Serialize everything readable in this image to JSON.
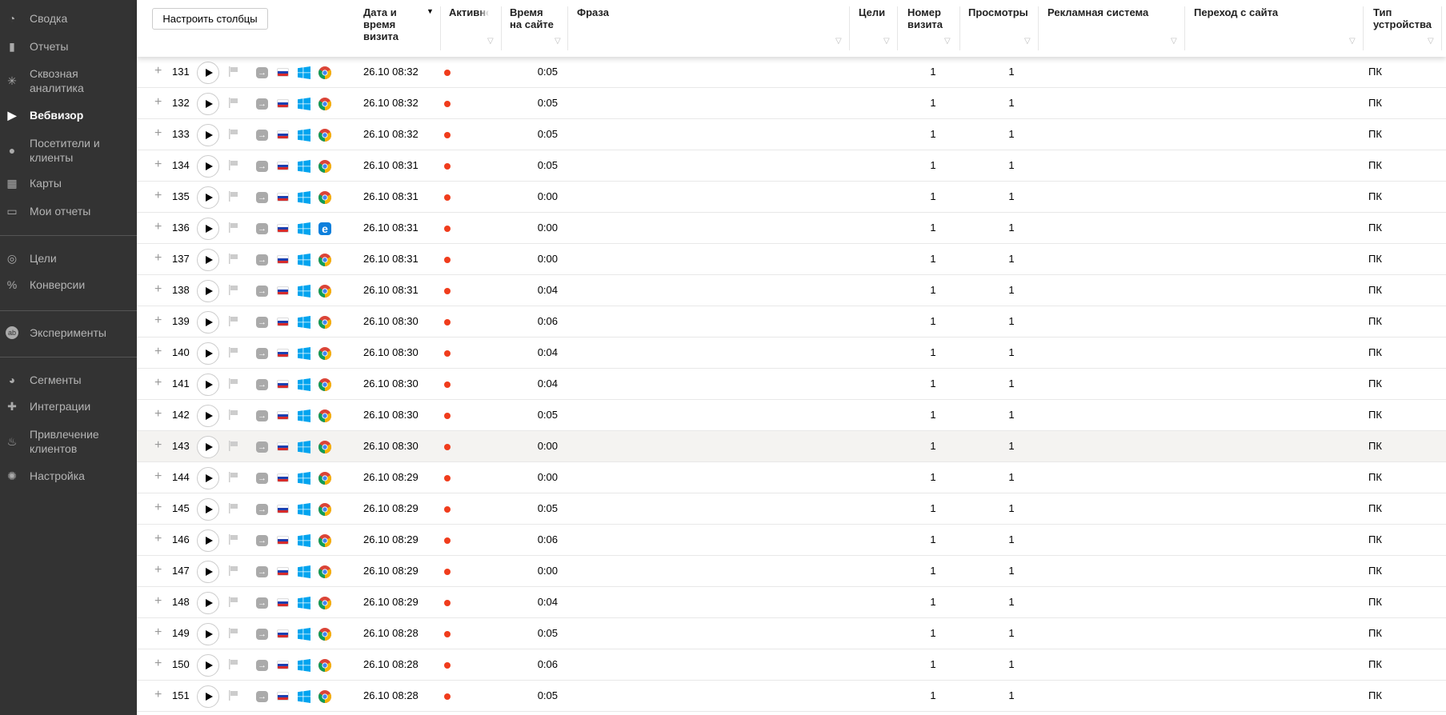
{
  "sidebar": {
    "items": [
      {
        "label": "Сводка",
        "icon": "gauge-icon"
      },
      {
        "label": "Отчеты",
        "icon": "bar-chart-icon"
      },
      {
        "label": "Сквозная аналитика",
        "icon": "snowflake-icon"
      },
      {
        "label": "Вебвизор",
        "icon": "play-icon",
        "active": true
      },
      {
        "label": "Посетители и клиенты",
        "icon": "person-icon"
      },
      {
        "label": "Карты",
        "icon": "map-icon"
      },
      {
        "label": "Мои отчеты",
        "icon": "inbox-icon"
      },
      {
        "label": "Цели",
        "icon": "target-cursor-icon"
      },
      {
        "label": "Конверсии",
        "icon": "percent-icon"
      },
      {
        "label": "Эксперименты",
        "icon": "ab-icon"
      },
      {
        "label": "Сегменты",
        "icon": "pie-icon"
      },
      {
        "label": "Интеграции",
        "icon": "puzzle-icon"
      },
      {
        "label": "Привлечение клиентов",
        "icon": "flame-icon"
      },
      {
        "label": "Настройка",
        "icon": "gear-icon"
      }
    ]
  },
  "toolbar": {
    "configure_columns": "Настроить столбцы"
  },
  "columns": {
    "date": "Дата и время визита",
    "active": "Активность",
    "time": "Время на сайте",
    "phrase": "Фраза",
    "goals": "Цели",
    "visit_number": "Номер визита",
    "views": "Просмотры",
    "ad_system": "Рекламная система",
    "referrer": "Переход с сайта",
    "device": "Тип устройства"
  },
  "sort": {
    "column": "date",
    "direction": "desc",
    "icon": "sort-down-icon"
  },
  "colors": {
    "sidebar_bg": "#333333",
    "active_dot": "#f03c1c",
    "windows": "#00a4ef",
    "edge": "#0c7fdc",
    "hover_row": "#f4f3f1"
  },
  "rows": [
    {
      "num": "131",
      "date": "26.10 08:32",
      "time": "0:05",
      "browser": "chrome",
      "visit_number": "1",
      "views": "1",
      "device": "ПК"
    },
    {
      "num": "132",
      "date": "26.10 08:32",
      "time": "0:05",
      "browser": "chrome",
      "visit_number": "1",
      "views": "1",
      "device": "ПК"
    },
    {
      "num": "133",
      "date": "26.10 08:32",
      "time": "0:05",
      "browser": "chrome",
      "visit_number": "1",
      "views": "1",
      "device": "ПК"
    },
    {
      "num": "134",
      "date": "26.10 08:31",
      "time": "0:05",
      "browser": "chrome",
      "visit_number": "1",
      "views": "1",
      "device": "ПК"
    },
    {
      "num": "135",
      "date": "26.10 08:31",
      "time": "0:00",
      "browser": "chrome",
      "visit_number": "1",
      "views": "1",
      "device": "ПК"
    },
    {
      "num": "136",
      "date": "26.10 08:31",
      "time": "0:00",
      "browser": "edge",
      "visit_number": "1",
      "views": "1",
      "device": "ПК"
    },
    {
      "num": "137",
      "date": "26.10 08:31",
      "time": "0:00",
      "browser": "chrome",
      "visit_number": "1",
      "views": "1",
      "device": "ПК"
    },
    {
      "num": "138",
      "date": "26.10 08:31",
      "time": "0:04",
      "browser": "chrome",
      "visit_number": "1",
      "views": "1",
      "device": "ПК"
    },
    {
      "num": "139",
      "date": "26.10 08:30",
      "time": "0:06",
      "browser": "chrome",
      "visit_number": "1",
      "views": "1",
      "device": "ПК"
    },
    {
      "num": "140",
      "date": "26.10 08:30",
      "time": "0:04",
      "browser": "chrome",
      "visit_number": "1",
      "views": "1",
      "device": "ПК"
    },
    {
      "num": "141",
      "date": "26.10 08:30",
      "time": "0:04",
      "browser": "chrome",
      "visit_number": "1",
      "views": "1",
      "device": "ПК"
    },
    {
      "num": "142",
      "date": "26.10 08:30",
      "time": "0:05",
      "browser": "chrome",
      "visit_number": "1",
      "views": "1",
      "device": "ПК"
    },
    {
      "num": "143",
      "date": "26.10 08:30",
      "time": "0:00",
      "browser": "chrome",
      "visit_number": "1",
      "views": "1",
      "device": "ПК",
      "hovered": true
    },
    {
      "num": "144",
      "date": "26.10 08:29",
      "time": "0:00",
      "browser": "chrome",
      "visit_number": "1",
      "views": "1",
      "device": "ПК"
    },
    {
      "num": "145",
      "date": "26.10 08:29",
      "time": "0:05",
      "browser": "chrome",
      "visit_number": "1",
      "views": "1",
      "device": "ПК"
    },
    {
      "num": "146",
      "date": "26.10 08:29",
      "time": "0:06",
      "browser": "chrome",
      "visit_number": "1",
      "views": "1",
      "device": "ПК"
    },
    {
      "num": "147",
      "date": "26.10 08:29",
      "time": "0:00",
      "browser": "chrome",
      "visit_number": "1",
      "views": "1",
      "device": "ПК"
    },
    {
      "num": "148",
      "date": "26.10 08:29",
      "time": "0:04",
      "browser": "chrome",
      "visit_number": "1",
      "views": "1",
      "device": "ПК"
    },
    {
      "num": "149",
      "date": "26.10 08:28",
      "time": "0:05",
      "browser": "chrome",
      "visit_number": "1",
      "views": "1",
      "device": "ПК"
    },
    {
      "num": "150",
      "date": "26.10 08:28",
      "time": "0:06",
      "browser": "chrome",
      "visit_number": "1",
      "views": "1",
      "device": "ПК"
    },
    {
      "num": "151",
      "date": "26.10 08:28",
      "time": "0:05",
      "browser": "chrome",
      "visit_number": "1",
      "views": "1",
      "device": "ПК"
    }
  ]
}
